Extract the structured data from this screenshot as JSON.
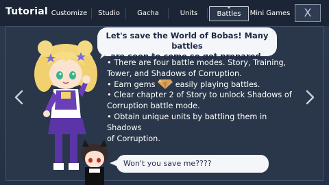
{
  "header": {
    "title": "Tutorial",
    "tabs": [
      {
        "label": "Customize"
      },
      {
        "label": "Studio"
      },
      {
        "label": "Gacha"
      },
      {
        "label": "Units"
      },
      {
        "label": "Battles"
      },
      {
        "label": "Mini Games"
      }
    ],
    "active_tab": "Battles",
    "close_label": "X"
  },
  "dialog": {
    "headline_line1": "Let's save the World of Bobas! Many battles",
    "headline_line2": "are soon to come so get prepared.",
    "bullets": {
      "b1_l1": "• There are four battle modes. Story, Training,",
      "b1_l2": "Tower, and Shadows of Corruption.",
      "b2_pre": "• Earn gems",
      "b2_post": "easily playing battles.",
      "b3_l1": "• Clear chapter 2 of Story to unlock Shadows of",
      "b3_l2": "Corruption battle mode.",
      "b4_l1": "• Obtain unique units by battling them in Shadows",
      "b4_l2": "of Corruption."
    },
    "reply": "Won't you save me????"
  },
  "colors": {
    "background": "#273448",
    "topbar": "#1c2535",
    "bubble": "#f5f6fa",
    "bubble_text": "#1e2a45",
    "gem": "#d9a15a"
  },
  "icons": {
    "prev": "chevron-left-icon",
    "next": "chevron-right-icon",
    "close": "close-icon",
    "gem": "gem-icon"
  }
}
